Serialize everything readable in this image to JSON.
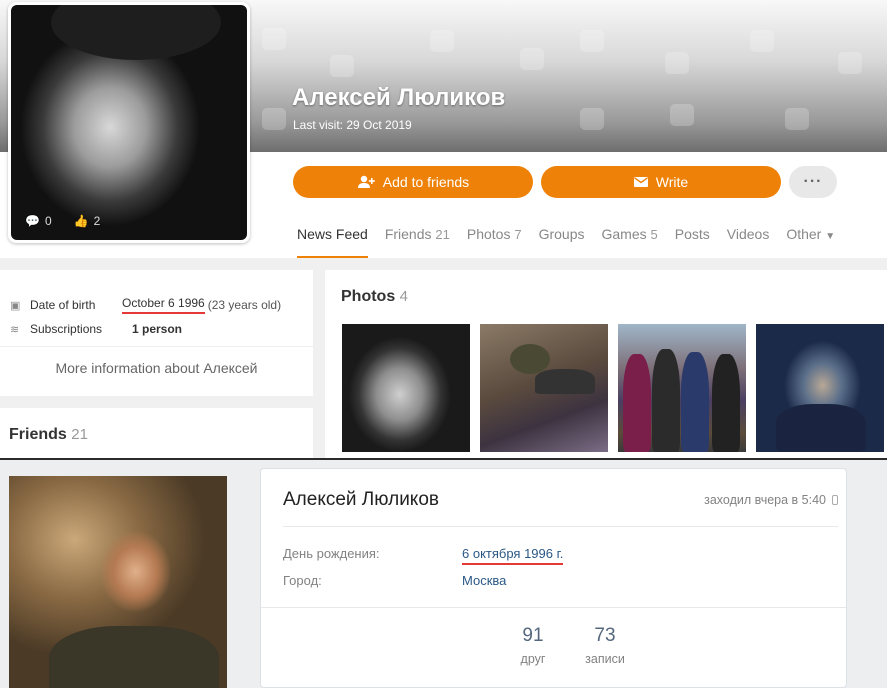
{
  "ok": {
    "name": "Алексей Люликов",
    "last_visit": "Last visit: 29 Oct 2019",
    "avatar_stats": {
      "comments": "0",
      "likes": "2"
    },
    "buttons": {
      "add_friends": "Add to friends",
      "write": "Write",
      "more": "···"
    },
    "tabs": [
      {
        "label": "News Feed",
        "count": ""
      },
      {
        "label": "Friends",
        "count": "21"
      },
      {
        "label": "Photos",
        "count": "7"
      },
      {
        "label": "Groups",
        "count": ""
      },
      {
        "label": "Games",
        "count": "5"
      },
      {
        "label": "Posts",
        "count": ""
      },
      {
        "label": "Videos",
        "count": ""
      },
      {
        "label": "Other",
        "count": ""
      }
    ],
    "info": {
      "dob_label": "Date of birth",
      "dob_value": "October 6 1996",
      "dob_age": "(23 years old)",
      "subs_label": "Subscriptions",
      "subs_value": "1 person",
      "more_info": "More information about Алексей"
    },
    "friends": {
      "title": "Friends",
      "count": "21"
    },
    "photos": {
      "title": "Photos",
      "count": "4"
    },
    "colors": {
      "accent": "#ee8208",
      "underline": "#e53935"
    }
  },
  "vk": {
    "name": "Алексей Люликов",
    "online": "заходил вчера в 5:40",
    "rows": [
      {
        "label": "День рождения:",
        "value": "6 октября 1996 г."
      },
      {
        "label": "Город:",
        "value": "Москва"
      }
    ],
    "counters": [
      {
        "value": "91",
        "label": "друг"
      },
      {
        "value": "73",
        "label": "записи"
      }
    ],
    "colors": {
      "link": "#2a5885"
    }
  }
}
